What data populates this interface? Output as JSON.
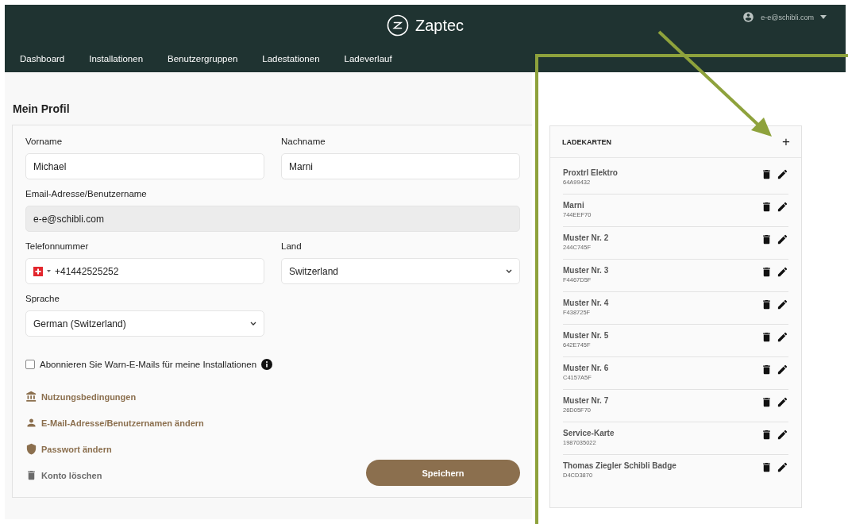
{
  "header": {
    "brand": "Zaptec",
    "user": "e-e@schibli.com",
    "nav": [
      {
        "label": "Dashboard"
      },
      {
        "label": "Installationen"
      },
      {
        "label": "Benutzergruppen"
      },
      {
        "label": "Ladestationen"
      },
      {
        "label": "Ladeverlauf"
      }
    ]
  },
  "profile": {
    "title": "Mein Profil",
    "rows": [
      [
        {
          "kind": "text",
          "label": "Vorname",
          "value": "Michael"
        },
        {
          "kind": "text",
          "label": "Nachname",
          "value": "Marni"
        }
      ],
      [
        {
          "kind": "readonly",
          "label": "Email-Adresse/Benutzername",
          "value": "e-e@schibli.com"
        }
      ],
      [
        {
          "kind": "phone",
          "label": "Telefonnummer",
          "value": "+41442525252"
        },
        {
          "kind": "select",
          "label": "Land",
          "value": "Switzerland"
        }
      ],
      [
        {
          "kind": "select",
          "label": "Sprache",
          "value": "German (Switzerland)"
        }
      ]
    ],
    "checkbox": {
      "label": "Abonnieren Sie Warn-E-Mails für meine Installationen",
      "checked": false
    },
    "links": [
      {
        "kind": "terms",
        "label": "Nutzungsbedingungen"
      },
      {
        "kind": "account",
        "label": "E-Mail-Adresse/Benutzernamen ändern"
      },
      {
        "kind": "password",
        "label": "Passwort ändern"
      },
      {
        "kind": "delete",
        "label": "Konto löschen"
      }
    ],
    "save_button": "Speichern"
  },
  "cards": {
    "title": "LADEKARTEN",
    "add": "+",
    "items": [
      {
        "name": "Proxtrl Elektro",
        "id": "64A99432"
      },
      {
        "name": "Marni",
        "id": "744EEF70"
      },
      {
        "name": "Muster Nr. 2",
        "id": "244C745F"
      },
      {
        "name": "Muster Nr. 3",
        "id": "F4467D5F"
      },
      {
        "name": "Muster Nr. 4",
        "id": "F438725F"
      },
      {
        "name": "Muster Nr. 5",
        "id": "642E745F"
      },
      {
        "name": "Muster Nr. 6",
        "id": "C4157A5F"
      },
      {
        "name": "Muster Nr. 7",
        "id": "26D05F70"
      },
      {
        "name": "Service-Karte",
        "id": "1987035022"
      },
      {
        "name": "Thomas Ziegler Schibli Badge",
        "id": "D4CD3870"
      }
    ]
  }
}
